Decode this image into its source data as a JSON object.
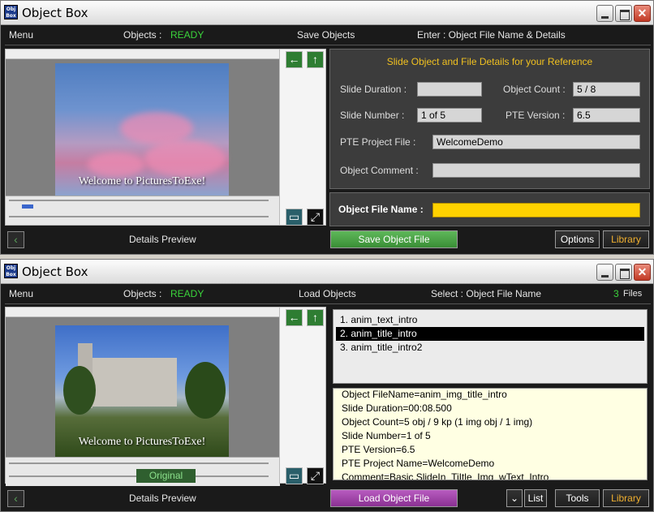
{
  "window_title": "Object Box",
  "top": {
    "menu": {
      "menu_label": "Menu",
      "objects_label": "Objects :",
      "objects_status": "READY",
      "action_label": "Save Objects",
      "hint_label": "Enter : Object File Name & Details"
    },
    "preview_caption": "Welcome to PicturesToExe!",
    "details_header": "Slide Object and File Details for your Reference",
    "fields": {
      "slide_duration_label": "Slide Duration :",
      "slide_duration_value": "",
      "object_count_label": "Object Count :",
      "object_count_value": "5 / 8",
      "slide_number_label": "Slide Number :",
      "slide_number_value": "1 of 5",
      "pte_version_label": "PTE Version :",
      "pte_version_value": "6.5",
      "pte_project_label": "PTE Project File :",
      "pte_project_value": "WelcomeDemo",
      "object_comment_label": "Object Comment :",
      "object_comment_value": "",
      "object_file_name_label": "Object File Name :",
      "object_file_name_value": ""
    },
    "details_preview_label": "Details Preview",
    "save_button": "Save Object File",
    "options_button": "Options",
    "library_button": "Library"
  },
  "bottom": {
    "menu": {
      "menu_label": "Menu",
      "objects_label": "Objects :",
      "objects_status": "READY",
      "action_label": "Load Objects",
      "hint_label": "Select : Object File Name",
      "files_count": "3",
      "files_label": "Files"
    },
    "preview_caption": "Welcome to PicturesToExe!",
    "original_label": "Original",
    "list_items": [
      "1.  anim_text_intro",
      "2.  anim_title_intro",
      "3.  anim_title_intro2"
    ],
    "selected_index": 1,
    "info_lines": [
      "Object FileName=anim_img_title_intro",
      "Slide Duration=00:08.500",
      "Object Count=5 obj / 9 kp  (1 img obj / 1 img)",
      "Slide Number=1 of 5",
      "PTE Version=6.5",
      "PTE Project Name=WelcomeDemo",
      "Comment=Basic SlideIn_TiItle_Img_wText_Intro"
    ],
    "details_preview_label": "Details Preview",
    "load_button": "Load Object File",
    "list_button": "List",
    "tools_button": "Tools",
    "library_button": "Library"
  },
  "colors": {
    "ready": "#3bd43b",
    "header_text": "#f0c020",
    "filename_field": "#ffd200",
    "save_button": "#4aa246",
    "load_button": "#a046aa",
    "library_text": "#f0b030"
  },
  "icons": {
    "back": "arrow-left-icon",
    "up": "arrow-up-icon",
    "monitor": "monitor-icon",
    "expand": "expand-icon",
    "collapse": "chevron-left-icon",
    "list_toggle": "chevron-down-icon"
  }
}
